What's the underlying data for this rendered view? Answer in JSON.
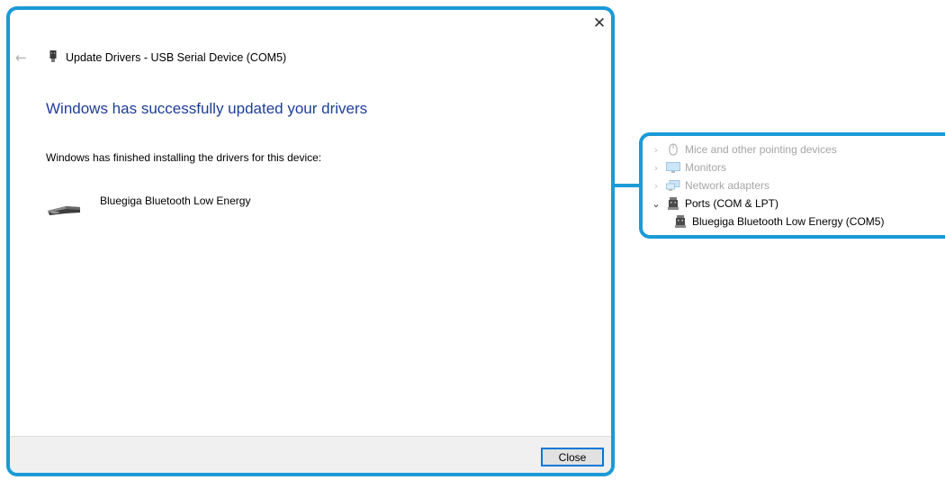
{
  "dialog": {
    "title": "Update Drivers - USB Serial Device (COM5)",
    "heading": "Windows has successfully updated your drivers",
    "description": "Windows has finished installing the drivers for this device:",
    "device_name": "Bluegiga Bluetooth Low Energy",
    "close_glyph": "✕",
    "back_glyph": "←",
    "close_button": "Close"
  },
  "device_manager": {
    "items": [
      {
        "label": "Mice and other pointing devices",
        "icon": "mouse-icon",
        "state": "collapsed",
        "dimmed": true
      },
      {
        "label": "Monitors",
        "icon": "monitor-icon",
        "state": "collapsed",
        "dimmed": true
      },
      {
        "label": "Network adapters",
        "icon": "network-adapter-icon",
        "state": "collapsed",
        "dimmed": true
      },
      {
        "label": "Ports (COM & LPT)",
        "icon": "port-icon",
        "state": "expanded",
        "dimmed": false
      },
      {
        "label": "Bluegiga Bluetooth Low Energy (COM5)",
        "icon": "port-icon",
        "state": "child",
        "dimmed": false
      }
    ],
    "chevron_collapsed": "›",
    "chevron_expanded": "⌄"
  },
  "colors": {
    "highlight_border": "#1a9ad6",
    "heading_blue": "#1e3d9b",
    "footer_bg": "#f0f0f0",
    "button_border": "#0078d7"
  }
}
